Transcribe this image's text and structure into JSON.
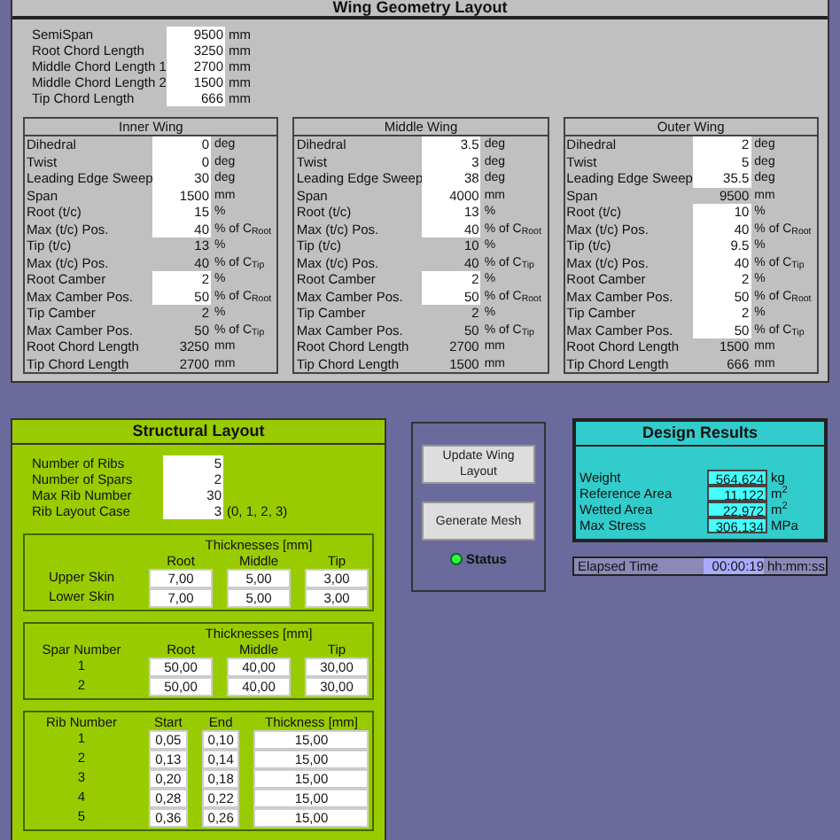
{
  "title": "Wing Geometry Layout",
  "geometry": [
    {
      "label": "SemiSpan",
      "value": "9500",
      "unit": "mm"
    },
    {
      "label": "Root Chord Length",
      "value": "3250",
      "unit": "mm"
    },
    {
      "label": "Middle Chord Length 1",
      "value": "2700",
      "unit": "mm"
    },
    {
      "label": "Middle Chord Length 2",
      "value": "1500",
      "unit": "mm"
    },
    {
      "label": "Tip Chord Length",
      "value": "666",
      "unit": "mm"
    }
  ],
  "wings": [
    {
      "title": "Inner Wing",
      "rows": [
        {
          "label": "Dihedral",
          "value": "0",
          "unit": "deg",
          "editable": true
        },
        {
          "label": "Twist",
          "value": "0",
          "unit": "deg",
          "editable": true
        },
        {
          "label": "Leading Edge Sweep",
          "value": "30",
          "unit": "deg",
          "editable": true
        },
        {
          "label": "Span",
          "value": "1500",
          "unit": "mm",
          "editable": true
        },
        {
          "label": "Root (t/c)",
          "value": "15",
          "unit": "%",
          "editable": true
        },
        {
          "label": "Max (t/c) Pos.",
          "value": "40",
          "unit": "% of C$_{Root}$",
          "editable": true
        },
        {
          "label": "Tip (t/c)",
          "value": "13",
          "unit": "%",
          "editable": false
        },
        {
          "label": "Max (t/c) Pos.",
          "value": "40",
          "unit": "% of C$_{Tip}$",
          "editable": false
        },
        {
          "label": "Root Camber",
          "value": "2",
          "unit": "%",
          "editable": true
        },
        {
          "label": "Max Camber Pos.",
          "value": "50",
          "unit": "% of C$_{Root}$",
          "editable": true
        },
        {
          "label": "Tip Camber",
          "value": "2",
          "unit": "%",
          "editable": false
        },
        {
          "label": "Max Camber Pos.",
          "value": "50",
          "unit": "% of C$_{Tip}$",
          "editable": false
        },
        {
          "label": "Root Chord Length",
          "value": "3250",
          "unit": "mm",
          "editable": false
        },
        {
          "label": "Tip Chord Length",
          "value": "2700",
          "unit": "mm",
          "editable": false
        }
      ]
    },
    {
      "title": "Middle Wing",
      "rows": [
        {
          "label": "Dihedral",
          "value": "3.5",
          "unit": "deg",
          "editable": true
        },
        {
          "label": "Twist",
          "value": "3",
          "unit": "deg",
          "editable": true
        },
        {
          "label": "Leading Edge Sweep",
          "value": "38",
          "unit": "deg",
          "editable": true
        },
        {
          "label": "Span",
          "value": "4000",
          "unit": "mm",
          "editable": true
        },
        {
          "label": "Root (t/c)",
          "value": "13",
          "unit": "%",
          "editable": true
        },
        {
          "label": "Max (t/c) Pos.",
          "value": "40",
          "unit": "% of C$_{Root}$",
          "editable": true
        },
        {
          "label": "Tip (t/c)",
          "value": "10",
          "unit": "%",
          "editable": false
        },
        {
          "label": "Max (t/c) Pos.",
          "value": "40",
          "unit": "% of C$_{Tip}$",
          "editable": false
        },
        {
          "label": "Root Camber",
          "value": "2",
          "unit": "%",
          "editable": true
        },
        {
          "label": "Max Camber Pos.",
          "value": "50",
          "unit": "% of C$_{Root}$",
          "editable": true
        },
        {
          "label": "Tip Camber",
          "value": "2",
          "unit": "%",
          "editable": false
        },
        {
          "label": "Max Camber Pos.",
          "value": "50",
          "unit": "% of C$_{Tip}$",
          "editable": false
        },
        {
          "label": "Root Chord Length",
          "value": "2700",
          "unit": "mm",
          "editable": false
        },
        {
          "label": "Tip Chord Length",
          "value": "1500",
          "unit": "mm",
          "editable": false
        }
      ]
    },
    {
      "title": "Outer Wing",
      "rows": [
        {
          "label": "Dihedral",
          "value": "2",
          "unit": "deg",
          "editable": true
        },
        {
          "label": "Twist",
          "value": "5",
          "unit": "deg",
          "editable": true
        },
        {
          "label": "Leading Edge Sweep",
          "value": "35.5",
          "unit": "deg",
          "editable": true
        },
        {
          "label": "Span",
          "value": "9500",
          "unit": "mm",
          "editable": false
        },
        {
          "label": "Root (t/c)",
          "value": "10",
          "unit": "%",
          "editable": true
        },
        {
          "label": "Max (t/c) Pos.",
          "value": "40",
          "unit": "% of C$_{Root}$",
          "editable": true
        },
        {
          "label": "Tip (t/c)",
          "value": "9.5",
          "unit": "%",
          "editable": true
        },
        {
          "label": "Max (t/c) Pos.",
          "value": "40",
          "unit": "% of C$_{Tip}$",
          "editable": true
        },
        {
          "label": "Root Camber",
          "value": "2",
          "unit": "%",
          "editable": true
        },
        {
          "label": "Max Camber Pos.",
          "value": "50",
          "unit": "% of C$_{Root}$",
          "editable": true
        },
        {
          "label": "Tip Camber",
          "value": "2",
          "unit": "%",
          "editable": true
        },
        {
          "label": "Max Camber Pos.",
          "value": "50",
          "unit": "% of C$_{Tip}$",
          "editable": true
        },
        {
          "label": "Root Chord Length",
          "value": "1500",
          "unit": "mm",
          "editable": false
        },
        {
          "label": "Tip Chord Length",
          "value": "666",
          "unit": "mm",
          "editable": false
        }
      ]
    }
  ],
  "structural": {
    "title": "Structural Layout",
    "params": [
      {
        "label": "Number of Ribs",
        "value": "5"
      },
      {
        "label": "Number of Spars",
        "value": "2"
      },
      {
        "label": "Max Rib Number",
        "value": "30"
      },
      {
        "label": "Rib Layout Case",
        "value": "3",
        "note": "(0, 1, 2, 3)"
      }
    ],
    "skin": {
      "header": "Thicknesses [mm]",
      "columns": [
        "Root",
        "Middle",
        "Tip"
      ],
      "rows": [
        {
          "label": "Upper Skin",
          "values": [
            "7,00",
            "5,00",
            "3,00"
          ]
        },
        {
          "label": "Lower Skin",
          "values": [
            "7,00",
            "5,00",
            "3,00"
          ]
        }
      ]
    },
    "spars": {
      "header": "Thicknesses [mm]",
      "label": "Spar Number",
      "columns": [
        "Root",
        "Middle",
        "Tip"
      ],
      "rows": [
        {
          "label": "1",
          "values": [
            "50,00",
            "40,00",
            "30,00"
          ]
        },
        {
          "label": "2",
          "values": [
            "50,00",
            "40,00",
            "30,00"
          ]
        }
      ]
    },
    "ribs": {
      "label": "Rib Number",
      "columns": [
        "Start",
        "End",
        "Thickness [mm]"
      ],
      "rows": [
        {
          "label": "1",
          "values": [
            "0,05",
            "0,10",
            "15,00"
          ]
        },
        {
          "label": "2",
          "values": [
            "0,13",
            "0,14",
            "15,00"
          ]
        },
        {
          "label": "3",
          "values": [
            "0,20",
            "0,18",
            "15,00"
          ]
        },
        {
          "label": "4",
          "values": [
            "0,28",
            "0,22",
            "15,00"
          ]
        },
        {
          "label": "5",
          "values": [
            "0,36",
            "0,26",
            "15,00"
          ]
        }
      ]
    }
  },
  "buttons": [
    "Update Wing Layout",
    "Generate Mesh"
  ],
  "status": {
    "label": "Status",
    "on": true
  },
  "results": {
    "title": "Design Results",
    "rows": [
      {
        "label": "Weight",
        "value": "564,624",
        "unit": "kg"
      },
      {
        "label": "Reference Area",
        "value": "11,122",
        "unit": "m$^{2}$"
      },
      {
        "label": "Wetted Area",
        "value": "22,972",
        "unit": "m$^{2}$"
      },
      {
        "label": "Max Stress",
        "value": "306,134",
        "unit": "MPa"
      }
    ]
  },
  "elapsed": {
    "label": "Elapsed Time",
    "value": "00:00:19",
    "unit": "hh:mm:ss"
  }
}
